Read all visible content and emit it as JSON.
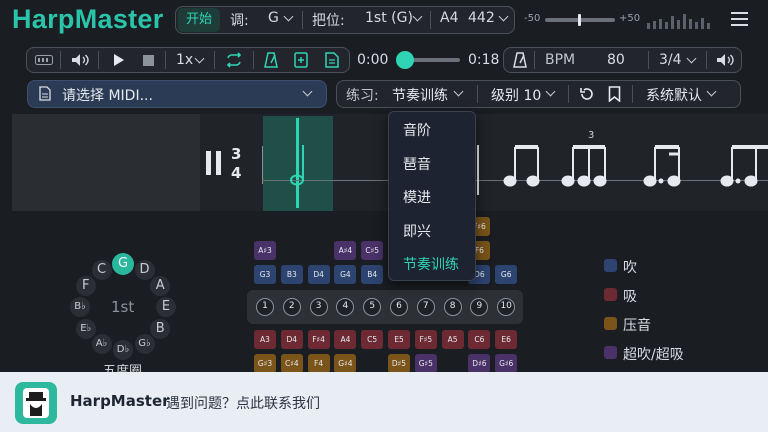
{
  "header": {
    "brand": "HarpMaster",
    "start_label": "开始",
    "key_label": "调:",
    "key_value": "G",
    "position_label": "把位:",
    "position_value": "1st (G)",
    "tuning_note": "A4",
    "tuning_freq": "442",
    "range_min": "-50",
    "range_max": "+50"
  },
  "toolbar": {
    "speed": "1x",
    "time_start": "0:00",
    "time_end": "0:18",
    "bpm_label": "BPM",
    "bpm_value": "80",
    "time_sig": "3/4",
    "playback_progress": 0.05
  },
  "file_select": {
    "placeholder": "请选择 MIDI..."
  },
  "practice": {
    "label": "练习:",
    "mode": "节奏训练",
    "level": "级别 10",
    "preset": "系统默认"
  },
  "notation": {
    "time_top": "3",
    "time_bottom": "4",
    "triplet": "3"
  },
  "menu": {
    "items": [
      {
        "label": "音阶",
        "active": false
      },
      {
        "label": "琶音",
        "active": false
      },
      {
        "label": "模进",
        "active": false
      },
      {
        "label": "即兴",
        "active": false
      },
      {
        "label": "节奏训练",
        "active": true
      }
    ]
  },
  "circle_of_fifths": {
    "center": "1st",
    "caption": "五度圈",
    "notes": [
      "G",
      "D",
      "A",
      "E",
      "B",
      "G♭",
      "D♭",
      "A♭",
      "E♭",
      "B♭",
      "F",
      "C"
    ],
    "selected": "G"
  },
  "harp": {
    "holes": [
      "1",
      "2",
      "3",
      "4",
      "5",
      "6",
      "7",
      "8",
      "9",
      "10"
    ],
    "top_overblow": [
      "A♯3",
      "",
      "",
      "A♯4",
      "C♯5",
      "",
      "",
      "",
      "",
      ""
    ],
    "top_bend": [
      "",
      "",
      "",
      "",
      "",
      "",
      "",
      "",
      "F♯6",
      ""
    ],
    "top_bend2": [
      "",
      "",
      "",
      "",
      "",
      "",
      "",
      "F♯6",
      "F6",
      ""
    ],
    "blow": [
      "G3",
      "B3",
      "D4",
      "G4",
      "B4",
      "",
      "",
      "",
      "D6",
      "G6"
    ],
    "draw": [
      "A3",
      "D4",
      "F♯4",
      "A4",
      "C5",
      "E5",
      "F♯5",
      "A5",
      "C6",
      "E6"
    ],
    "draw_bend": [
      "G♯3",
      "C♯4",
      "F4",
      "G♯4",
      "",
      "D♯5",
      "G♯5",
      "",
      "D♯6",
      "G♯6"
    ]
  },
  "legend": [
    {
      "label": "吹",
      "color": "#2d4470"
    },
    {
      "label": "吸",
      "color": "#6d2a33"
    },
    {
      "label": "压音",
      "color": "#7a5418"
    },
    {
      "label": "超吹/超吸",
      "color": "#4a3168"
    }
  ],
  "banner": {
    "app_name": "HarpMaster",
    "message": "遇到问题？点此联系我们"
  }
}
